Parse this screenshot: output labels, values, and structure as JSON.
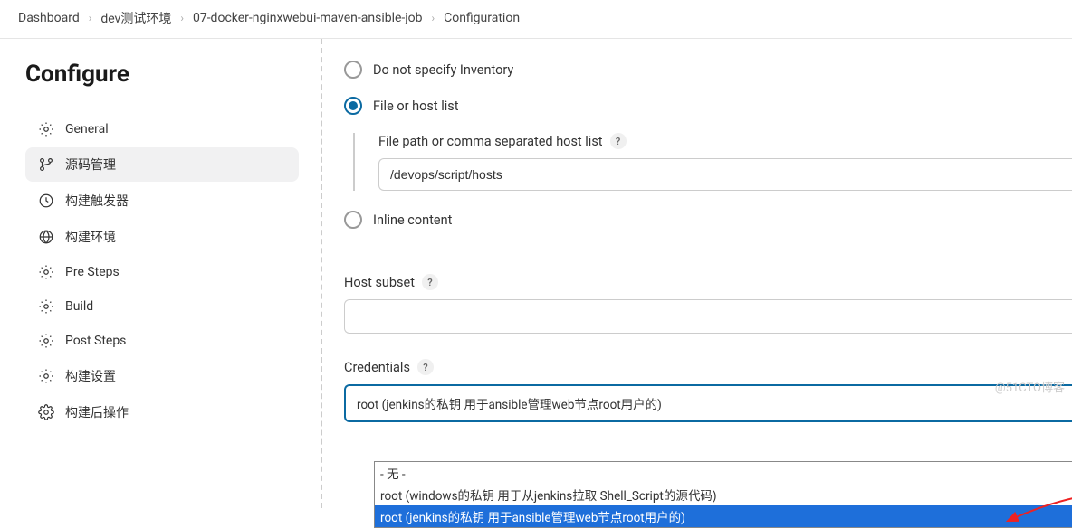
{
  "breadcrumb": {
    "items": [
      {
        "label": "Dashboard"
      },
      {
        "label": "dev测试环境"
      },
      {
        "label": "07-docker-nginxwebui-maven-ansible-job"
      },
      {
        "label": "Configuration"
      }
    ]
  },
  "page_title": "Configure",
  "sidebar": {
    "items": [
      {
        "label": "General",
        "icon": "gear"
      },
      {
        "label": "源码管理",
        "icon": "branch",
        "active": true
      },
      {
        "label": "构建触发器",
        "icon": "clock"
      },
      {
        "label": "构建环境",
        "icon": "globe"
      },
      {
        "label": "Pre Steps",
        "icon": "gear"
      },
      {
        "label": "Build",
        "icon": "gear"
      },
      {
        "label": "Post Steps",
        "icon": "gear"
      },
      {
        "label": "构建设置",
        "icon": "gear"
      },
      {
        "label": "构建后操作",
        "icon": "gear-complex"
      }
    ]
  },
  "form": {
    "inventory": {
      "radio_none": "Do not specify Inventory",
      "radio_file": "File or host list",
      "radio_inline": "Inline content",
      "file_label": "File path or comma separated host list",
      "file_value": "/devops/script/hosts"
    },
    "host_subset": {
      "label": "Host subset",
      "value": ""
    },
    "credentials": {
      "label": "Credentials",
      "selected": "root (jenkins的私钥 用于ansible管理web节点root用户的)",
      "options": [
        {
          "label": "- 无 -"
        },
        {
          "label": "root (windows的私钥 用于从jenkins拉取 Shell_Script的源代码)"
        },
        {
          "label": "root (jenkins的私钥 用于ansible管理web节点root用户的)",
          "highlighted": true
        }
      ]
    }
  },
  "watermark": "@51CTO博客"
}
